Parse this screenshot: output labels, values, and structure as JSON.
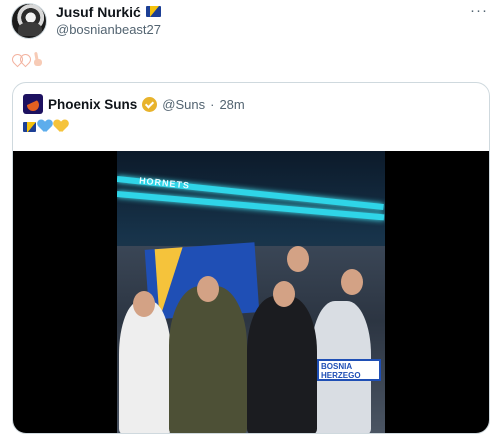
{
  "post": {
    "author": {
      "display_name": "Jusuf Nurkić",
      "handle": "@bosnianbeast27",
      "name_icon": "bosnia-flag-icon"
    },
    "more_icon_label": "···",
    "text_icons": [
      "heart-hands-icon",
      "crossed-fingers-icon"
    ]
  },
  "quote": {
    "author": {
      "display_name": "Phoenix Suns",
      "verified": true,
      "handle": "@Suns",
      "separator": "·",
      "time": "28m",
      "logo_icon": "suns-logo-icon"
    },
    "text_icons": [
      "bosnia-flag-icon",
      "blue-heart-icon",
      "yellow-heart-icon"
    ],
    "media": {
      "type": "video",
      "ribbon_text": "HORNETS",
      "scarf_text": "BOSNIA HERZEGO"
    }
  },
  "colors": {
    "text_primary": "#0f1419",
    "text_secondary": "#536471",
    "border": "#cfd9de",
    "verified_gold": "#e8b32c",
    "heart_blue": "#5dadec",
    "heart_yellow": "#f5c33b"
  }
}
